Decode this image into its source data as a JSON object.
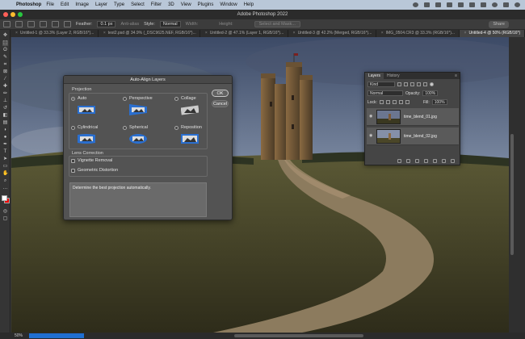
{
  "menubar": {
    "app": "Photoshop",
    "items": [
      "File",
      "Edit",
      "Image",
      "Layer",
      "Type",
      "Select",
      "Filter",
      "3D",
      "View",
      "Plugins",
      "Window",
      "Help"
    ]
  },
  "window": {
    "title": "Adobe Photoshop 2022"
  },
  "options_bar": {
    "feather_label": "Feather:",
    "feather_value": "0.1 px",
    "antialias_label": "Anti-alias",
    "style_label": "Style:",
    "style_value": "Normal",
    "width_label": "Width:",
    "height_label": "Height:",
    "select_mask_label": "Select and Mask...",
    "share_label": "Share"
  },
  "tabs": [
    {
      "label": "Untitled-1 @ 33.3% (Layer 2, RGB/16*)..."
    },
    {
      "label": "test2.psd @ 34.9% (_DSC9625.NEF, RGB/16*)..."
    },
    {
      "label": "Untitled-2 @ 47.1% (Layer 1, RGB/16*)..."
    },
    {
      "label": "Untitled-3 @ 42.2% (Merged, RGB/16*)..."
    },
    {
      "label": "IMG_0504.CR3 @ 33.3% (RGB/16*)..."
    },
    {
      "label": "Untitled-4 @ 50% (RGB/16*)",
      "active": true
    }
  ],
  "dialog": {
    "title": "Auto-Align Layers",
    "ok_label": "OK",
    "cancel_label": "Cancel",
    "projection_label": "Projection",
    "options": [
      {
        "label": "Auto",
        "selected": true
      },
      {
        "label": "Perspective",
        "selected": false
      },
      {
        "label": "Collage",
        "selected": false
      },
      {
        "label": "Cylindrical",
        "selected": false
      },
      {
        "label": "Spherical",
        "selected": false
      },
      {
        "label": "Reposition",
        "selected": false
      }
    ],
    "lens_label": "Lens Correction",
    "vignette_label": "Vignette Removal",
    "geometric_label": "Geometric Distortion",
    "description": "Determine the best projection automatically."
  },
  "layers_panel": {
    "tab_layers": "Layers",
    "tab_history": "History",
    "kind_label": "Kind",
    "blend_mode": "Normal",
    "opacity_label": "Opacity:",
    "opacity_value": "100%",
    "lock_label": "Lock:",
    "fill_label": "Fill:",
    "fill_value": "100%",
    "layers": [
      {
        "name": "time_blend_01.jpg"
      },
      {
        "name": "time_blend_02.jpg"
      }
    ]
  },
  "status": {
    "zoom": "50%"
  },
  "colors": {
    "accent": "#1f6fd1",
    "panel": "#535353"
  }
}
